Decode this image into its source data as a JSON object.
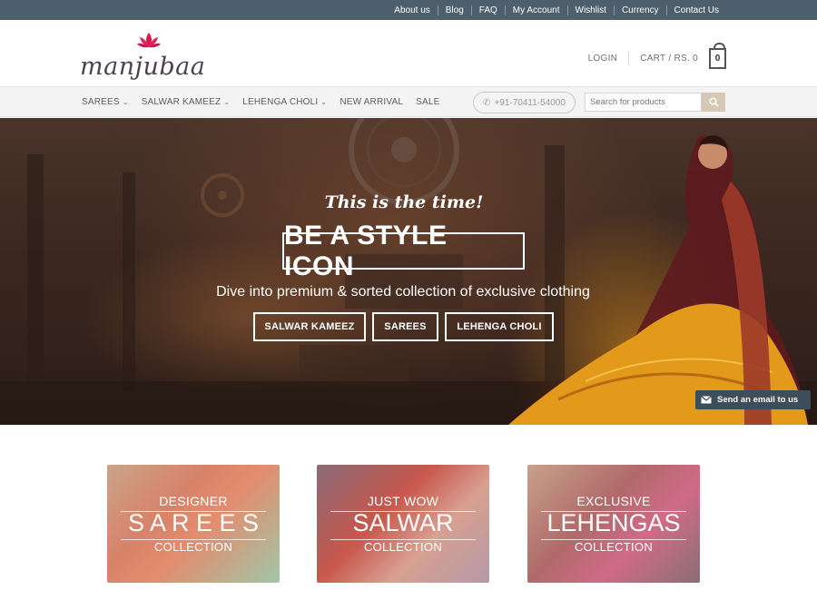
{
  "topbar": {
    "links": [
      "About us",
      "Blog",
      "FAQ",
      "My Account",
      "Wishlist",
      "Currency",
      "Contact Us"
    ]
  },
  "header": {
    "logo_text": "manjubaa",
    "login": "LOGIN",
    "cart": "CART / RS. 0",
    "cart_count": "0"
  },
  "nav": {
    "items": [
      {
        "label": "SAREES",
        "has_dropdown": true
      },
      {
        "label": "SALWAR KAMEEZ",
        "has_dropdown": true
      },
      {
        "label": "LEHENGA CHOLI",
        "has_dropdown": true
      },
      {
        "label": "NEW ARRIVAL",
        "has_dropdown": false
      },
      {
        "label": "SALE",
        "has_dropdown": false
      }
    ],
    "phone": "+91-70411-54000",
    "search_placeholder": "Search for products"
  },
  "hero": {
    "tagline": "This is the time!",
    "title": "BE A STYLE ICON",
    "subtitle": "Dive into premium & sorted collection of exclusive clothing",
    "buttons": [
      "SALWAR KAMEEZ",
      "SAREES",
      "LEHENGA CHOLI"
    ]
  },
  "email_tab": {
    "label": "Send an email to us"
  },
  "collections": [
    {
      "top": "DESIGNER",
      "main": "S A R E E S",
      "bottom": "COLLECTION"
    },
    {
      "top": "JUST WOW",
      "main": "SALWAR",
      "bottom": "COLLECTION"
    },
    {
      "top": "EXCLUSIVE",
      "main": "LEHENGAS",
      "bottom": "COLLECTION"
    }
  ],
  "colors": {
    "topbar": "#4d5f6d",
    "accent_flower": "#d81b4f",
    "search_button": "#d6c8b4"
  }
}
